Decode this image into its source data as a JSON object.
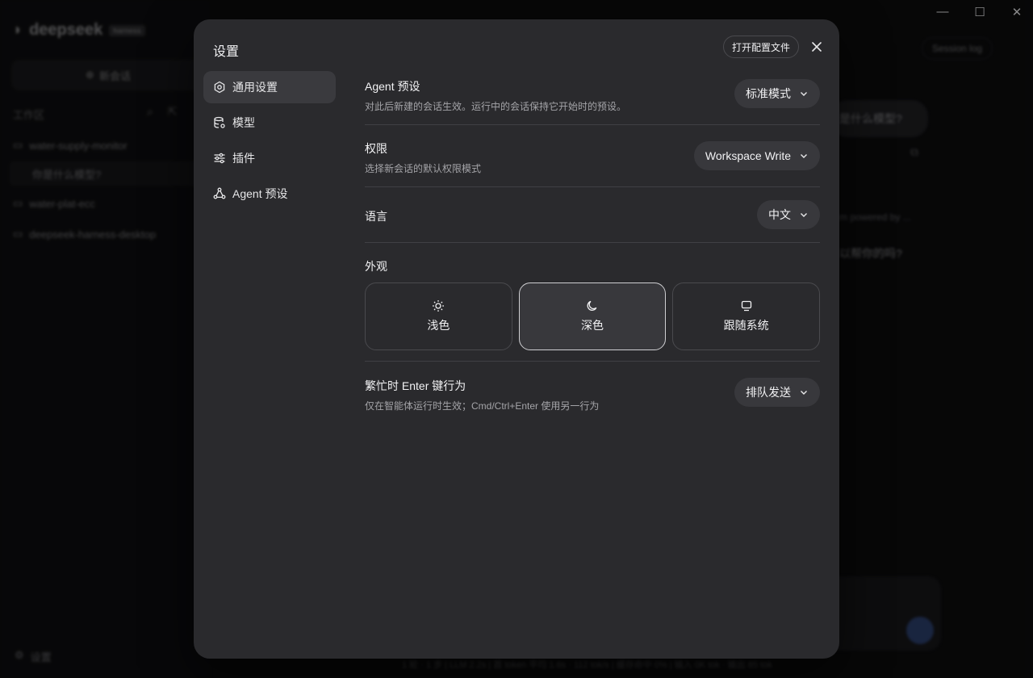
{
  "background": {
    "brand_name": "deepseek",
    "brand_badge": "harness",
    "new_chat_label": "新会话",
    "workspace_label": "工作区",
    "workspace_items": [
      {
        "label": "water-supply-monitor"
      },
      {
        "label": "你是什么模型?"
      },
      {
        "label": "water-plat-ecc"
      },
      {
        "label": "deepseek-harness-desktop"
      }
    ],
    "settings_label": "设置",
    "session_log_label": "Session log",
    "bubble_text": "是什么模型?",
    "assistant_text_1": "m powered by ...",
    "assistant_text_2": "以帮你的吗?",
    "status_bar": "1 轮 · 1 步  |  LLM 2.2s  |  首 token 平均 1.6s · 112 tok/s  |  缓存命中 0%  |  输入 0K tok · 输出 85 tok"
  },
  "modal": {
    "title": "设置",
    "open_config_label": "打开配置文件",
    "nav": [
      {
        "label": "通用设置",
        "icon": "gear-icon",
        "active": true
      },
      {
        "label": "模型",
        "icon": "database-gear-icon",
        "active": false
      },
      {
        "label": "插件",
        "icon": "sliders-icon",
        "active": false
      },
      {
        "label": "Agent 预设",
        "icon": "nodes-icon",
        "active": false
      }
    ],
    "settings": {
      "agent_preset": {
        "title": "Agent 预设",
        "desc": "对此后新建的会话生效。运行中的会话保持它开始时的预设。",
        "value": "标准模式"
      },
      "permission": {
        "title": "权限",
        "desc": "选择新会话的默认权限模式",
        "value": "Workspace Write"
      },
      "language": {
        "title": "语言",
        "value": "中文"
      },
      "appearance": {
        "title": "外观",
        "options": [
          {
            "label": "浅色",
            "icon": "sun-icon",
            "selected": false
          },
          {
            "label": "深色",
            "icon": "moon-icon",
            "selected": true
          },
          {
            "label": "跟随系统",
            "icon": "monitor-icon",
            "selected": false
          }
        ]
      },
      "busy_enter": {
        "title": "繁忙时 Enter 键行为",
        "desc": "仅在智能体运行时生效；Cmd/Ctrl+Enter 使用另一行为",
        "value": "排队发送"
      }
    }
  }
}
